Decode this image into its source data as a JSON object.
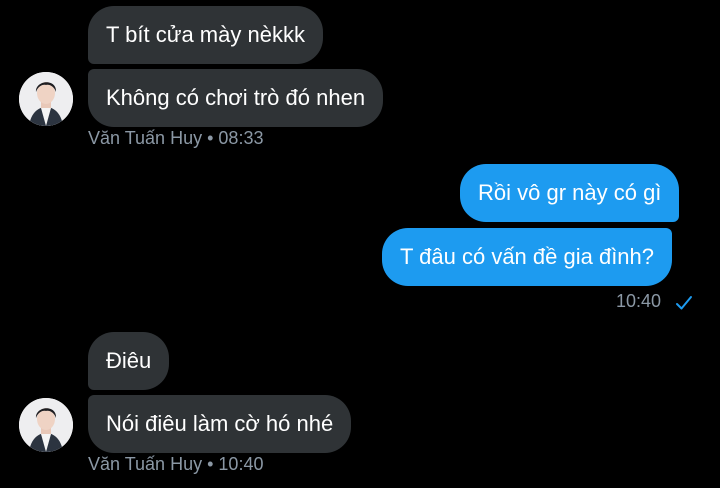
{
  "conversation": {
    "group1": {
      "messages": [
        "T bít cửa mày nèkkk",
        "Không có chơi trò đó nhen"
      ],
      "sender": "Văn Tuấn Huy",
      "separator": "•",
      "time": "08:33"
    },
    "group2": {
      "messages": [
        "Rồi vô gr này có gì",
        "T đâu có vấn đề gia đình?"
      ],
      "time": "10:40",
      "status_icon": "read-check-icon"
    },
    "group3": {
      "messages": [
        "Điêu",
        "Nói điêu làm cờ hó nhé"
      ],
      "sender": "Văn Tuấn Huy",
      "separator": "•",
      "time": "10:40"
    }
  },
  "colors": {
    "background": "#000000",
    "incoming_bubble": "#2f3336",
    "outgoing_bubble": "#1d9bf0",
    "meta_text": "#8b98a5"
  }
}
